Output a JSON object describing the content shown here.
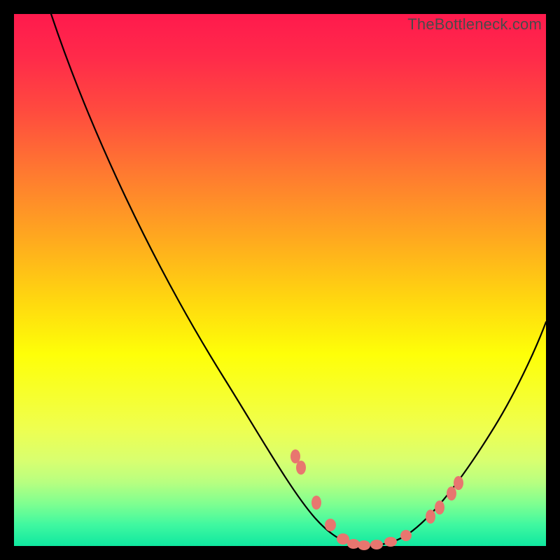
{
  "watermark": "TheBottleneck.com",
  "colors": {
    "gradient_top": "#ff1a4d",
    "gradient_mid": "#feff08",
    "gradient_bottom": "#10e8a0",
    "curve": "#000000",
    "marker": "#e8766f",
    "frame": "#000000"
  },
  "chart_data": {
    "type": "line",
    "title": "",
    "xlabel": "",
    "ylabel": "",
    "xlim": [
      0,
      100
    ],
    "ylim": [
      0,
      100
    ],
    "grid": false,
    "legend": false,
    "series": [
      {
        "name": "bottleneck-curve",
        "x": [
          7,
          10,
          15,
          20,
          25,
          30,
          35,
          40,
          45,
          50,
          53,
          56,
          58,
          60,
          62,
          64,
          66,
          68,
          70,
          73,
          76,
          80,
          85,
          90,
          95,
          100
        ],
        "y": [
          100,
          94,
          84,
          74,
          64,
          55,
          46,
          38,
          30,
          22,
          17,
          12,
          8,
          5,
          3,
          1,
          0,
          0,
          0,
          1,
          3,
          7,
          13,
          22,
          32,
          42
        ]
      }
    ],
    "markers": {
      "name": "highlighted-points",
      "x": [
        53,
        55,
        58,
        60,
        63,
        65,
        67,
        70,
        72,
        75,
        78,
        80,
        82
      ],
      "y": [
        17,
        14,
        8,
        5,
        2,
        1,
        0,
        0,
        1,
        2,
        5,
        7,
        10
      ]
    },
    "annotations": [
      {
        "text": "TheBottleneck.com",
        "pos": "top-right"
      }
    ]
  }
}
